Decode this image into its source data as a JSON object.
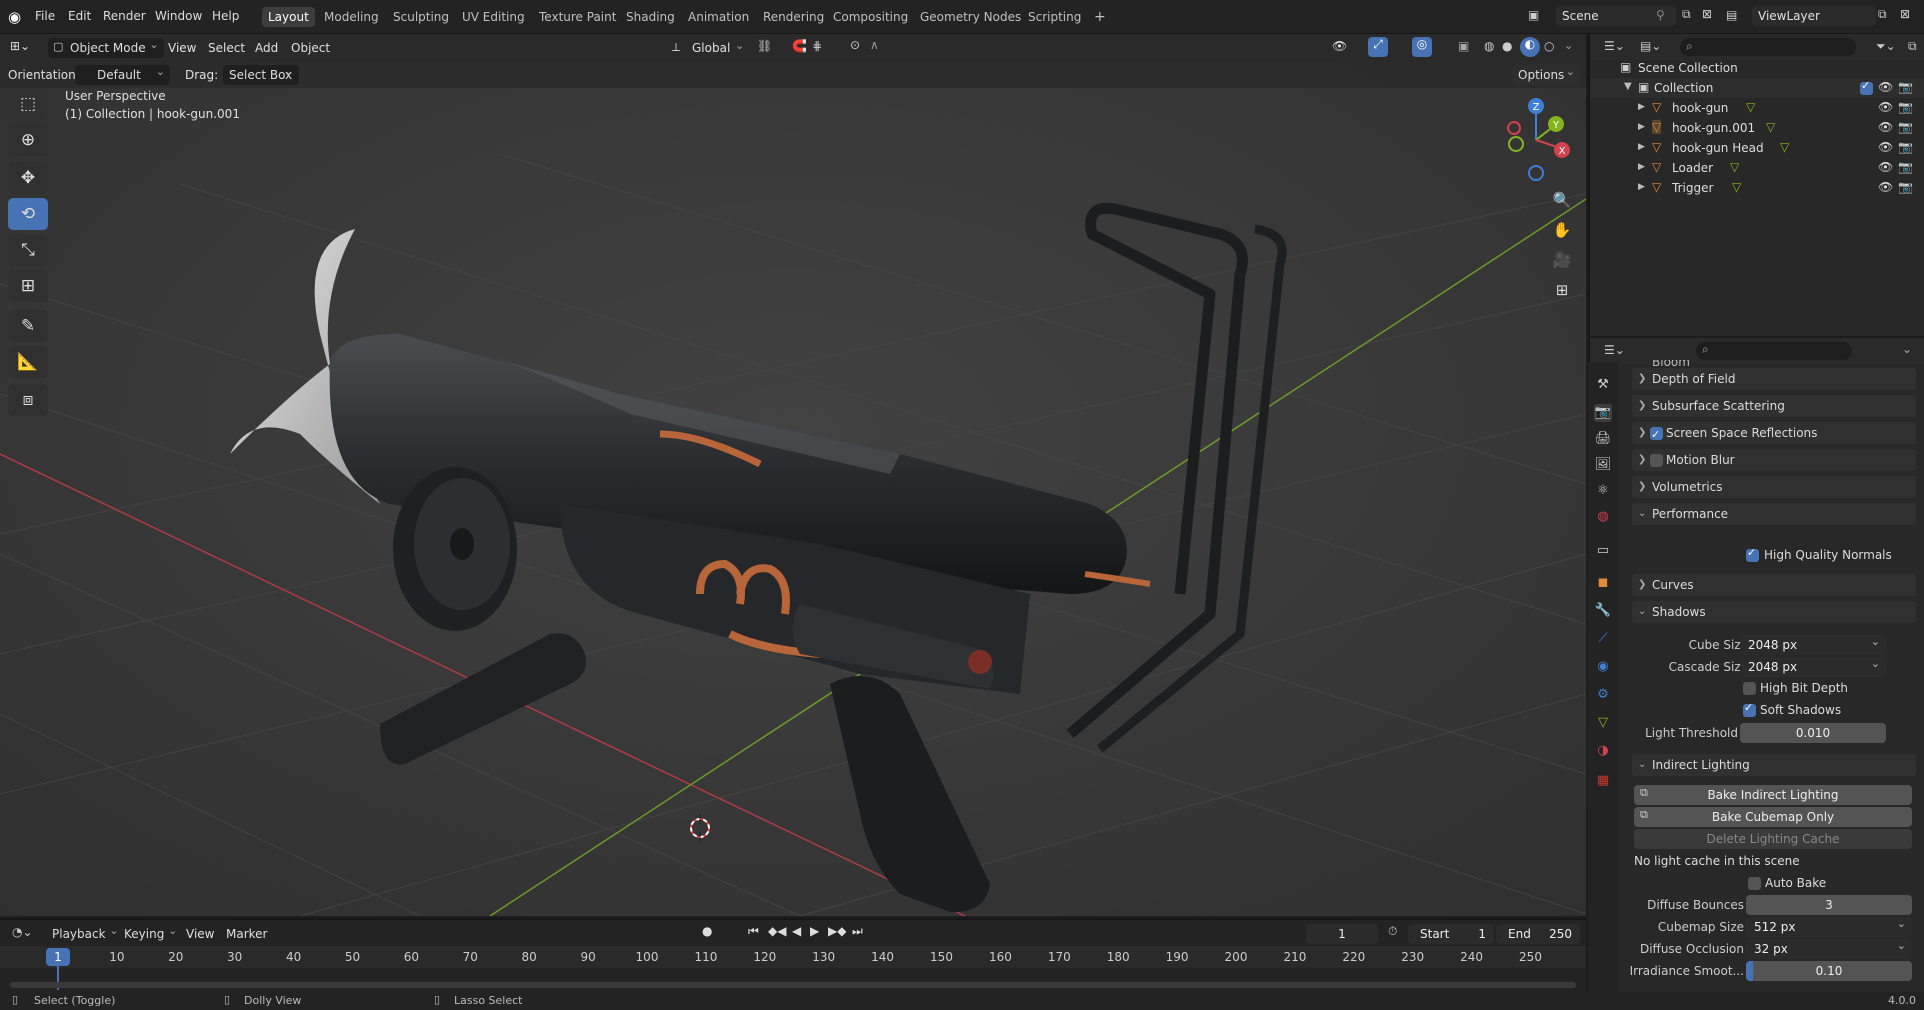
{
  "menu": {
    "items": [
      "File",
      "Edit",
      "Render",
      "Window",
      "Help"
    ]
  },
  "workspaces": [
    "Layout",
    "Modeling",
    "Sculpting",
    "UV Editing",
    "Texture Paint",
    "Shading",
    "Animation",
    "Rendering",
    "Compositing",
    "Geometry Nodes",
    "Scripting"
  ],
  "active_workspace": "Layout",
  "scene": {
    "scene_name": "Scene",
    "view_layer": "ViewLayer"
  },
  "viewport_header": {
    "mode": "Object Mode",
    "menus": [
      "View",
      "Select",
      "Add",
      "Object"
    ],
    "transform_orientation": "Global",
    "orientation_label": "Orientation:",
    "orientation_value": "Default",
    "drag_label": "Drag:",
    "drag_value": "Select Box",
    "options_label": "Options"
  },
  "viewport_overlay": {
    "perspective": "User Perspective",
    "collection_info": "(1) Collection | hook-gun.001"
  },
  "gizmo": {
    "z": "Z",
    "y": "Y",
    "x": "X"
  },
  "outliner": {
    "root": "Scene Collection",
    "collection": "Collection",
    "objects": [
      "hook-gun",
      "hook-gun.001",
      "hook-gun Head",
      "Loader",
      "Trigger"
    ]
  },
  "properties": {
    "partial_top": "Bloom",
    "panels_collapsed": [
      "Depth of Field",
      "Subsurface Scattering",
      "Screen Space Reflections",
      "Motion Blur",
      "Volumetrics"
    ],
    "ssr_checked": true,
    "motion_blur_checked": false,
    "performance": {
      "title": "Performance",
      "high_quality_normals": "High Quality Normals",
      "checked": true
    },
    "curves": "Curves",
    "shadows": {
      "title": "Shadows",
      "cube_size_label": "Cube Size",
      "cube_size": "2048 px",
      "cascade_size_label": "Cascade Size",
      "cascade_size": "2048 px",
      "high_bit_depth": "High Bit Depth",
      "high_bit_depth_checked": false,
      "soft_shadows": "Soft Shadows",
      "soft_shadows_checked": true,
      "light_threshold_label": "Light Threshold",
      "light_threshold": "0.010"
    },
    "indirect": {
      "title": "Indirect Lighting",
      "bake_indirect": "Bake Indirect Lighting",
      "bake_cubemap": "Bake Cubemap Only",
      "delete_cache": "Delete Lighting Cache",
      "status": "No light cache in this scene",
      "auto_bake": "Auto Bake",
      "auto_bake_checked": false,
      "diffuse_bounces_label": "Diffuse Bounces",
      "diffuse_bounces": "3",
      "cubemap_size_label": "Cubemap Size",
      "cubemap_size": "512 px",
      "diffuse_occlusion_label": "Diffuse Occlusion",
      "diffuse_occlusion": "32 px",
      "irradiance_smooth_label": "Irradiance Smoot...",
      "irradiance_smooth": "0.10",
      "irradiance_fraction": 0.04
    }
  },
  "timeline": {
    "menus": [
      "Playback",
      "Keying",
      "View",
      "Marker"
    ],
    "current_frame": "1",
    "start_label": "Start",
    "start": "1",
    "end_label": "End",
    "end": "250",
    "ticks": [
      "1",
      "10",
      "20",
      "30",
      "40",
      "50",
      "60",
      "70",
      "80",
      "90",
      "100",
      "110",
      "120",
      "130",
      "140",
      "150",
      "160",
      "170",
      "180",
      "190",
      "200",
      "210",
      "220",
      "230",
      "240",
      "250"
    ]
  },
  "status": {
    "left": "Select (Toggle)",
    "middle": "Dolly View",
    "right": "Lasso Select",
    "version": "4.0.0"
  },
  "colors": {
    "accent": "#4772b3",
    "x_axis": "#d1414e",
    "y_axis": "#84b51f",
    "z_axis": "#3f7fd6",
    "object_orange": "#e08a3c"
  }
}
